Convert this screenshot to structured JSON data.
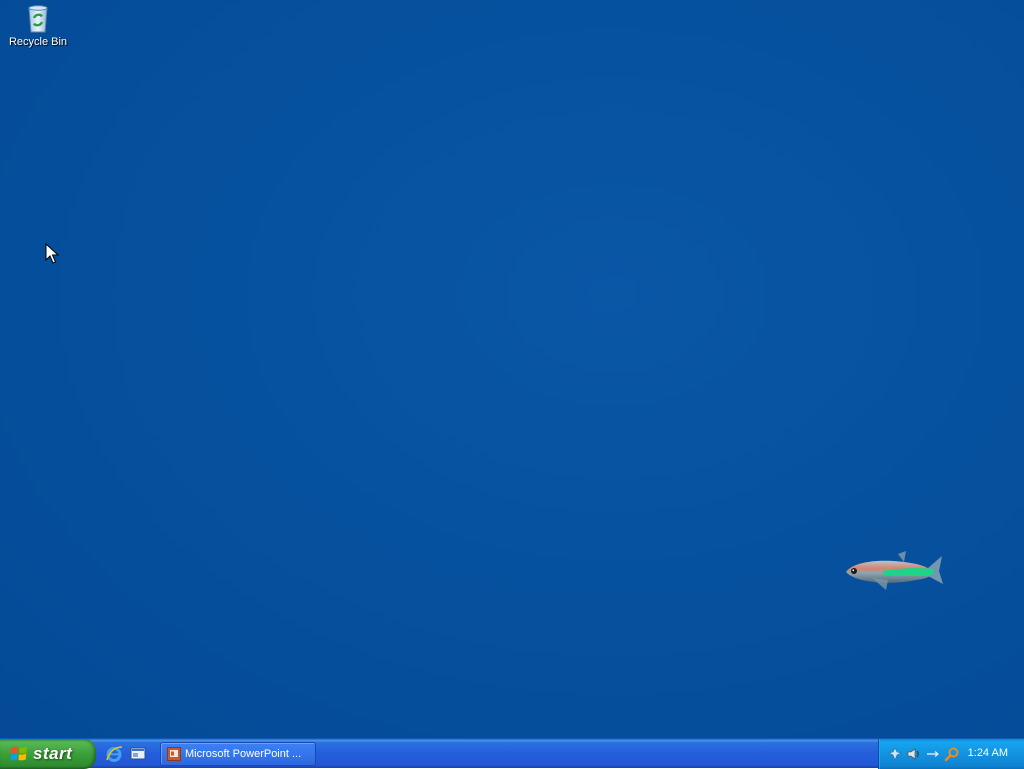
{
  "desktop": {
    "background_color": "#06519f",
    "icons": [
      {
        "label": "Recycle Bin",
        "icon": "recycle-bin-icon"
      }
    ],
    "wallpaper_object": "fish"
  },
  "taskbar": {
    "start_label": "start",
    "quick_launch": [
      {
        "icon": "internet-explorer-icon"
      },
      {
        "icon": "show-desktop-icon"
      }
    ],
    "tasks": [
      {
        "label": "Microsoft PowerPoint ...",
        "icon": "powerpoint-icon"
      }
    ],
    "tray": {
      "icons": [
        "network-icon",
        "volume-icon",
        "tray-arrow-icon",
        "search-icon"
      ],
      "clock": "1:24 AM"
    },
    "colors": {
      "bar": "#245edb",
      "start": "#3b9f3b",
      "tray": "#1293e0"
    }
  }
}
